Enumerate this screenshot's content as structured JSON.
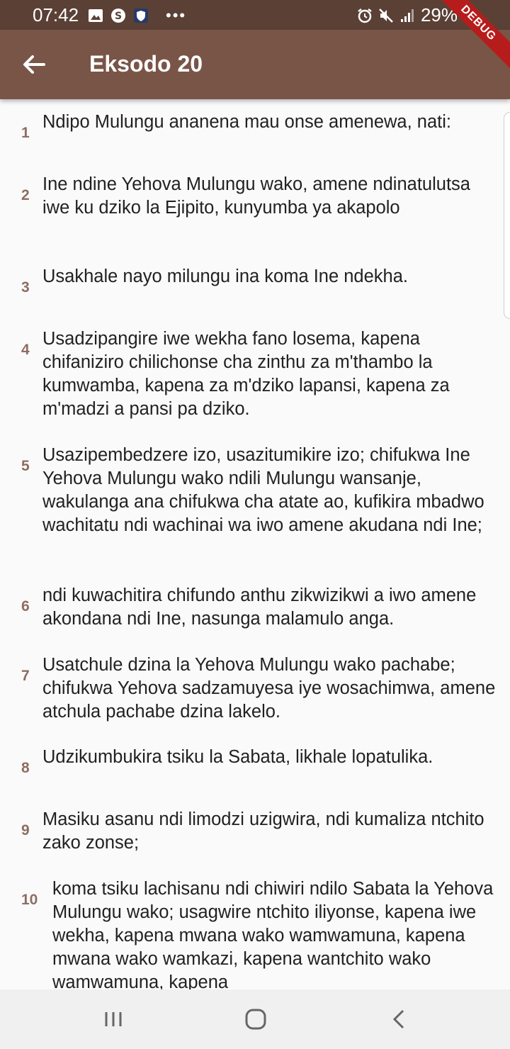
{
  "status": {
    "time": "07:42",
    "dots": "•••",
    "battery": "29%",
    "icons": [
      "image-icon",
      "s-icon",
      "shield-icon",
      "alarm-icon",
      "mute-icon",
      "signal-icon",
      "battery-icon"
    ]
  },
  "debug_label": "DEBUG",
  "app_bar": {
    "title": "Eksodo 20",
    "back_icon": "arrow-back-icon"
  },
  "verses": [
    {
      "num": "1",
      "text": "Ndipo Mulungu ananena mau onse amenewa, nati:"
    },
    {
      "num": "2",
      "text": "Ine ndine Yehova Mulungu wako, amene ndinatulutsa iwe ku dziko la Ejipito, kunyumba ya akapolo"
    },
    {
      "num": "3",
      "text": "Usakhale nayo milungu ina koma Ine ndekha."
    },
    {
      "num": "4",
      "text": "Usadzipangire iwe wekha fano losema, kapena chifaniziro chilichonse cha zinthu za m'thambo la kumwamba, kapena za m'dziko lapansi, kapena za m'madzi a pansi pa dziko."
    },
    {
      "num": "5",
      "text": "Usazipembedzere izo, usazitumikire izo; chifukwa Ine Yehova Mulungu wako ndili Mulungu wansanje, wakulanga ana chifukwa cha atate ao, kufikira mbadwo wachitatu ndi wachinai wa iwo amene akudana ndi Ine;"
    },
    {
      "num": "6",
      "text": "ndi kuwachitira chifundo anthu zikwizikwi a iwo amene akondana ndi Ine, nasunga malamulo anga."
    },
    {
      "num": "7",
      "text": "Usatchule dzina la Yehova Mulungu wako pachabe; chifukwa Yehova sadzamuyesa iye wosachimwa, amene atchula pachabe dzina lakelo."
    },
    {
      "num": "8",
      "text": "Udzikumbukira tsiku la Sabata, likhale lopatulika."
    },
    {
      "num": "9",
      "text": "Masiku asanu ndi limodzi uzigwira, ndi kumaliza ntchito zako zonse;"
    },
    {
      "num": "10",
      "text": "koma tsiku lachisanu ndi chiwiri ndilo Sabata la Yehova Mulungu wako; usagwire ntchito iliyonse, kapena iwe wekha, kapena mwana wako wamwamuna, kapena mwana wako wamkazi, kapena wantchito wako wamwamuna, kapena"
    }
  ],
  "nav": {
    "icons": [
      "recent-apps-icon",
      "home-icon",
      "back-icon"
    ]
  }
}
